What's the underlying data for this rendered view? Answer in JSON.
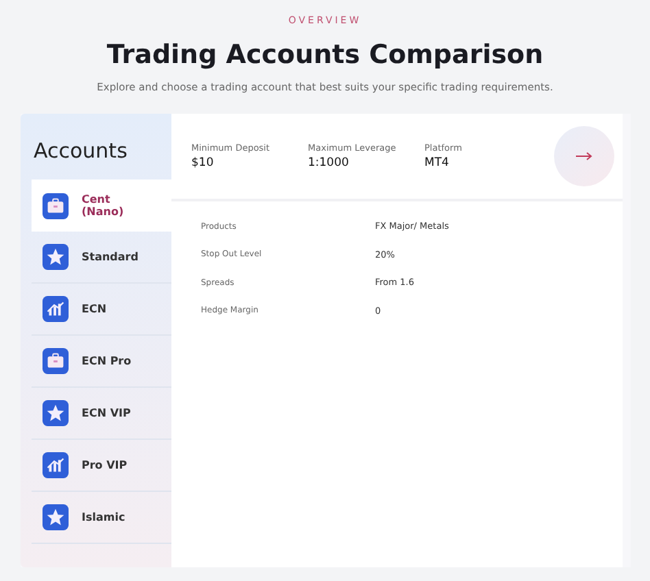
{
  "header": {
    "eyebrow": "OVERVIEW",
    "title": "Trading Accounts Comparison",
    "subtitle": "Explore and choose a trading account that best suits your specific trading requirements."
  },
  "sidebar": {
    "title": "Accounts",
    "items": [
      {
        "label": "Cent (Nano)",
        "kind": "briefcase",
        "selected": true
      },
      {
        "label": "Standard",
        "kind": "star",
        "selected": false
      },
      {
        "label": "ECN",
        "kind": "chart",
        "selected": false
      },
      {
        "label": "ECN Pro",
        "kind": "briefcase",
        "selected": false
      },
      {
        "label": "ECN VIP",
        "kind": "star",
        "selected": false
      },
      {
        "label": "Pro VIP",
        "kind": "chart",
        "selected": false
      },
      {
        "label": "Islamic",
        "kind": "star",
        "selected": false
      }
    ]
  },
  "summary": [
    {
      "label": "Minimum Deposit",
      "value": "$10"
    },
    {
      "label": "Maximum Leverage",
      "value": "1:1000"
    },
    {
      "label": "Platform",
      "value": "MT4"
    }
  ],
  "details": [
    {
      "label": "Products",
      "value": "FX Major/ Metals"
    },
    {
      "label": "Stop Out Level",
      "value": "20%"
    },
    {
      "label": "Spreads",
      "value": "From 1.6"
    },
    {
      "label": "Hedge Margin",
      "value": "0"
    }
  ]
}
